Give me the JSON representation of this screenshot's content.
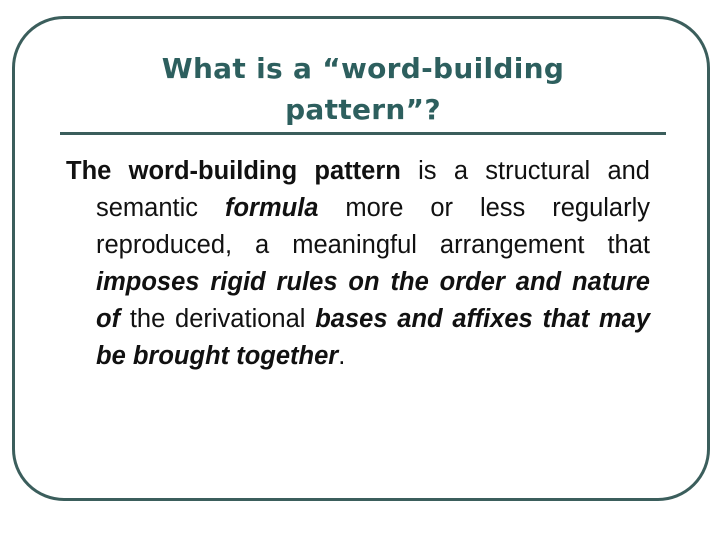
{
  "slide": {
    "title_lines": [
      "What is a “word-building",
      "pattern”?"
    ],
    "body": {
      "segments": [
        {
          "text": "The word-building pattern",
          "style": "bold"
        },
        {
          "text": " is a structural and semantic ",
          "style": "normal"
        },
        {
          "text": "formula",
          "style": "bold-italic"
        },
        {
          "text": " more or less regularly reproduced, a meaningful arrangement that ",
          "style": "normal"
        },
        {
          "text": "imposes rigid rules on the order and nature of",
          "style": "bold-italic"
        },
        {
          "text": " the derivational ",
          "style": "normal"
        },
        {
          "text": "bases and affixes that may be brought together",
          "style": "bold-italic"
        },
        {
          "text": ".",
          "style": "normal"
        }
      ]
    },
    "colors": {
      "title": "#2d5f5e",
      "frame": "#3b5e5c",
      "divider": "#3b5e5c",
      "body_text": "#111111",
      "background": "#ffffff"
    }
  }
}
